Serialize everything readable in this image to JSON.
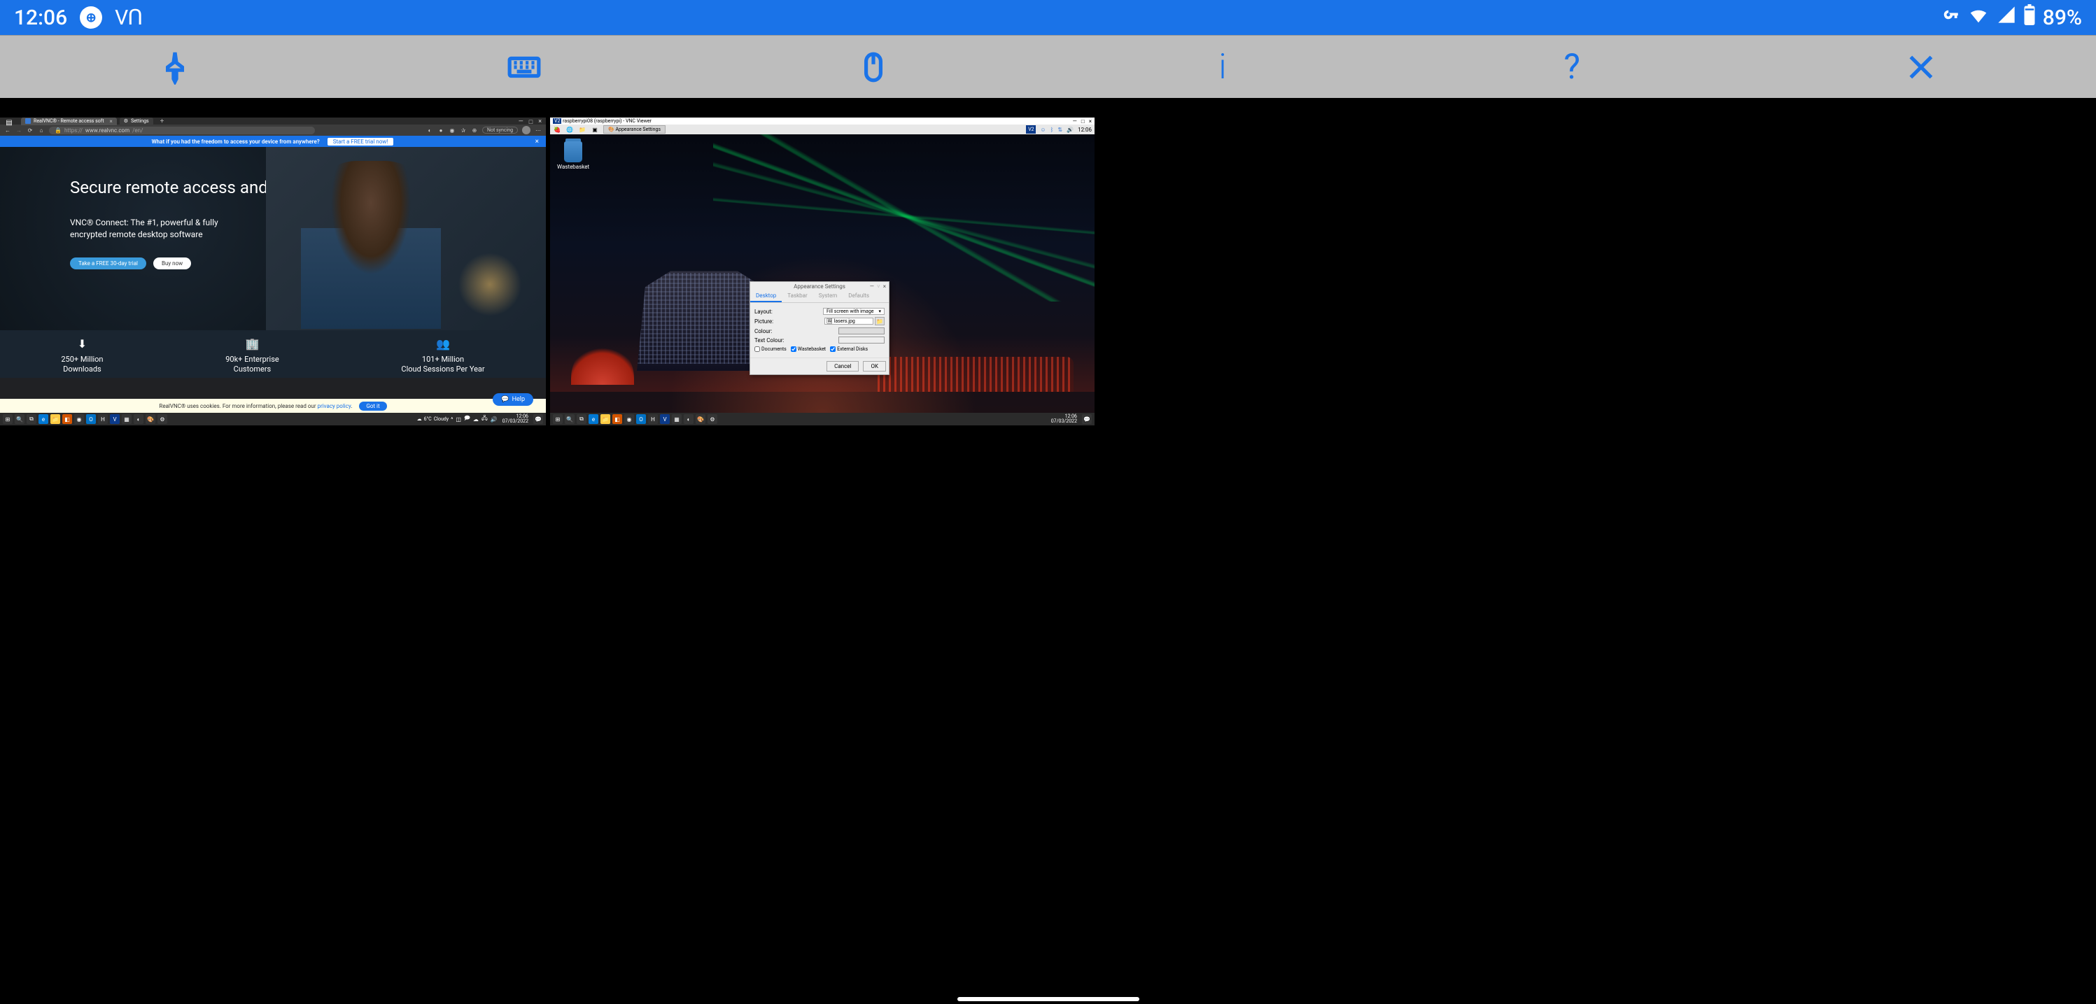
{
  "android_status": {
    "time": "12:06",
    "battery": "89%",
    "vnc_logo": "VՈ"
  },
  "vnc_toolbar": {
    "pin": "pin",
    "keyboard": "keyboard",
    "mouse": "mouse",
    "info": "i",
    "help": "?",
    "close": "✕"
  },
  "left": {
    "tabs": [
      {
        "label": "RealVNC® - Remote access soft",
        "active": true
      },
      {
        "label": "Settings",
        "active": false
      }
    ],
    "url_prefix": "https://",
    "url_host": "www.realvnc.com",
    "url_path": "/en/",
    "not_syncing": "Not syncing",
    "promo": {
      "text": "What if you had the freedom to access your device from anywhere?",
      "cta": "Start a FREE trial now!"
    },
    "hero": {
      "heading": "Secure remote access and support",
      "sub1": "VNC® Connect: The #1, powerful & fully",
      "sub2": "encrypted remote desktop software",
      "btn_primary": "Take a FREE 30-day trial",
      "btn_secondary": "Buy now"
    },
    "stats": [
      {
        "num": "250+ Million",
        "label": "Downloads"
      },
      {
        "num": "90k+ Enterprise",
        "label": "Customers"
      },
      {
        "num": "101+ Million",
        "label": "Cloud Sessions Per Year"
      }
    ],
    "cookie": {
      "text_a": "RealVNC® uses cookies. For more information, please read our ",
      "link": "privacy policy",
      "text_b": ".",
      "gotit": "Got it"
    },
    "help_fab": "Help",
    "taskbar": {
      "weather_temp": "6°C",
      "weather_text": "Cloudy",
      "time": "12:06",
      "date": "07/03/2022"
    }
  },
  "right": {
    "vnc_title": "raspberrypi08 (raspberrypi) - VNC Viewer",
    "panel_task": "Appearance Settings",
    "panel_time": "12:06",
    "wastebasket": "Wastebasket",
    "dialog": {
      "title": "Appearance Settings",
      "tabs": [
        "Desktop",
        "Taskbar",
        "System",
        "Defaults"
      ],
      "active_tab": "Desktop",
      "layout_label": "Layout:",
      "layout_value": "Fill screen with image",
      "picture_label": "Picture:",
      "picture_value": "lasers.jpg",
      "colour_label": "Colour:",
      "textcolour_label": "Text Colour:",
      "checks": [
        {
          "label": "Documents",
          "checked": false
        },
        {
          "label": "Wastebasket",
          "checked": true
        },
        {
          "label": "External Disks",
          "checked": true
        }
      ],
      "cancel": "Cancel",
      "ok": "OK"
    },
    "taskbar": {
      "time": "12:06",
      "date": "07/03/2022"
    }
  }
}
